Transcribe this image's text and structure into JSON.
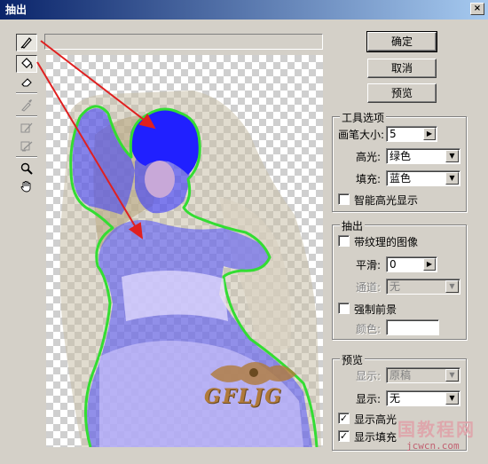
{
  "window": {
    "title": "抽出",
    "close_glyph": "×"
  },
  "tools": [
    {
      "name": "edge-highlighter-tool",
      "icon": "marker-pen-icon",
      "active": true
    },
    {
      "name": "fill-tool",
      "icon": "paint-bucket-icon",
      "active": true
    },
    {
      "name": "eraser-tool",
      "icon": "eraser-icon",
      "active": false
    },
    {
      "name": "eyedropper-tool",
      "icon": "eyedropper-icon",
      "active": false
    },
    {
      "name": "cleanup-tool",
      "icon": "cleanup-brush-icon",
      "active": false
    },
    {
      "name": "edge-touchup-tool",
      "icon": "edge-touchup-icon",
      "active": false
    },
    {
      "name": "zoom-tool",
      "icon": "magnifier-icon",
      "active": false
    },
    {
      "name": "hand-tool",
      "icon": "hand-icon",
      "active": false
    }
  ],
  "buttons": {
    "ok": "确定",
    "cancel": "取消",
    "preview": "预览"
  },
  "tool_options": {
    "title": "工具选项",
    "brush_size_label": "画笔大小:",
    "brush_size_value": "5",
    "highlight_label": "高光:",
    "highlight_value": "绿色",
    "fill_label": "填充:",
    "fill_value": "蓝色",
    "smart_highlight_label": "智能高光显示",
    "smart_highlight_checked": false
  },
  "extraction": {
    "title": "抽出",
    "textured_image_label": "带纹理的图像",
    "textured_image_checked": false,
    "smooth_label": "平滑:",
    "smooth_value": "0",
    "channel_label": "通道:",
    "channel_value": "无",
    "force_foreground_label": "强制前景",
    "force_foreground_checked": false,
    "color_label": "颜色:"
  },
  "preview_group": {
    "title": "预览",
    "show_label_1": "显示:",
    "show_value_1": "原稿",
    "show_label_2": "显示:",
    "show_value_2": "无",
    "show_highlight_label": "显示高光",
    "show_highlight_checked": true,
    "show_fill_label": "显示填充",
    "show_fill_checked": true
  },
  "canvas": {
    "watermark_text": "GFLJG"
  },
  "site_watermark": {
    "line1": "国教程网",
    "line2": "jcwcn.com"
  },
  "colors": {
    "highlight": "#33dd33",
    "fill": "#3a3aff",
    "arrow": "#e02020",
    "title_bar": "#0a246a"
  }
}
